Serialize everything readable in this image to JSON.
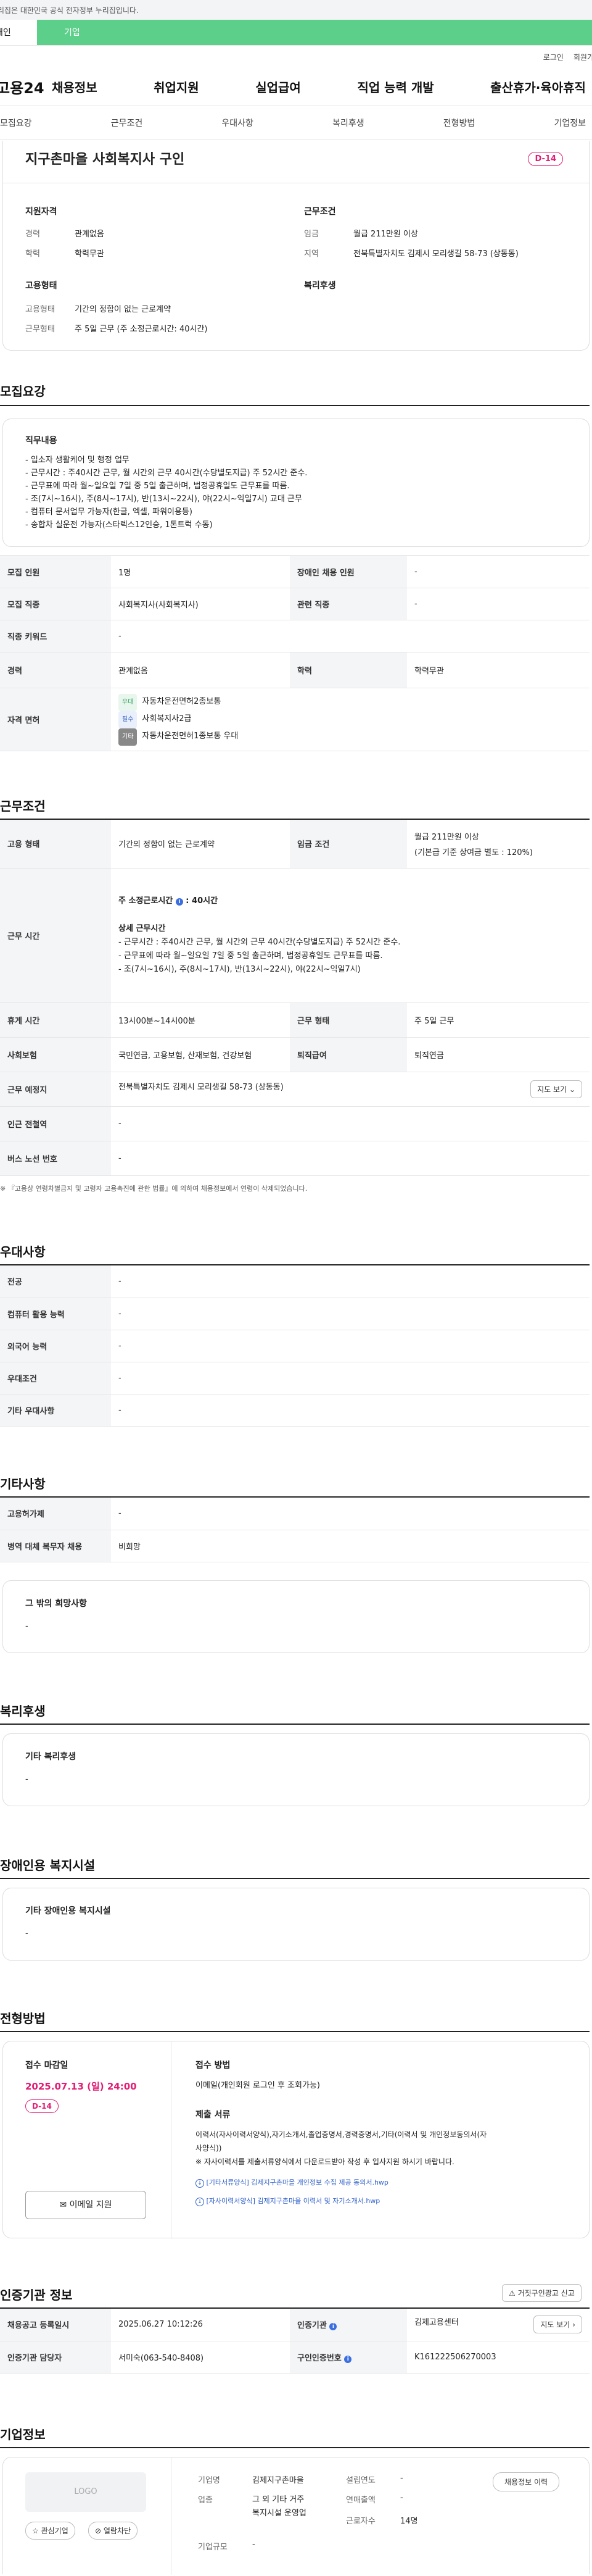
{
  "gov_banner": "이 누리집은 대한민국 공식 전자정부 누리집입니다.",
  "top_tabs": [
    "개인",
    "기업"
  ],
  "utility": {
    "login": "로그인",
    "join": "회원가입"
  },
  "logo": "고용24",
  "gnb": [
    "채용정보",
    "취업지원",
    "실업급여",
    "직업 능력 개발",
    "출산휴가·육아휴직"
  ],
  "subnav": [
    "모집요강",
    "근무조건",
    "우대사항",
    "복리후생",
    "전형방법",
    "기업정보"
  ],
  "header": {
    "title": "지구촌마을 사회복지사 구인",
    "dday": "D-14",
    "support_title": "지원자격",
    "career_label": "경력",
    "career_value": "관계없음",
    "edu_label": "학력",
    "edu_value": "학력무관",
    "cond_title": "근무조건",
    "wage_label": "임금",
    "wage_value": "월급 211만원 이상",
    "region_label": "지역",
    "region_value": "전북특별자치도 김제시 모리생길 58-73 (상동동)",
    "emp_title": "고용형태",
    "emp_label": "고용형태",
    "emp_value": "기간의 정함이 없는 근로계약",
    "worktype_label": "근무형태",
    "worktype_value": "주 5일 근무 (주 소정근로시간: 40시간)",
    "welfare_title": "복리후생"
  },
  "recruit": {
    "title": "모집요강",
    "duty_title": "직무내용",
    "duty_lines": [
      "- 입소자 생활케어 및 행정 업무",
      "- 근무시간 : 주40시간 근무, 월 시간외 근무 40시간(수당별도지급) 주 52시간 준수.",
      "- 근무표에 따라 월~일요일 7일 중 5일 출근하며, 법정공휴일도 근무표를 따름.",
      "- 조(7시~16시), 주(8시~17시), 반(13시~22시), 야(22시~익일7시) 교대 근무",
      "- 컴퓨터 문서업무 가능자(한글, 엑셀, 파워이용등)",
      "- 송합차 실운전 가능자(스타렉스12인승, 1톤트럭 수동)"
    ],
    "rows": {
      "count_l": "모집 인원",
      "count_v": "1명",
      "disabled_l": "장애인 채용 인원",
      "disabled_v": "-",
      "job_l": "모집 직종",
      "job_v": "사회복지사(사회복지사)",
      "rel_l": "관련 직종",
      "rel_v": "-",
      "kw_l": "직종 키워드",
      "kw_v": "-",
      "career_l": "경력",
      "career_v": "관계없음",
      "edu_l": "학력",
      "edu_v": "학력무관",
      "lic_l": "자격 면허",
      "licenses": [
        {
          "tag": "우대",
          "name": "자동차운전면허2종보통"
        },
        {
          "tag": "필수",
          "name": "사회복지사2급"
        },
        {
          "tag": "기타",
          "name": "자동차운전면허1종보통 우대"
        }
      ]
    }
  },
  "work": {
    "title": "근무조건",
    "emp_l": "고용 형태",
    "emp_v": "기간의 정함이 없는 근로계약",
    "wage_l": "임금 조건",
    "wage_v1": "월급 211만원 이상",
    "wage_v2": "(기본급 기준 상여금 별도 : 120%)",
    "time_l": "근무 시간",
    "time_head": "주 소정근로시간",
    "time_hours": "40시간",
    "time_detail_title": "상세 근무시간",
    "time_lines": [
      "- 근무시간 : 주40시간 근무, 월 시간외 근무 40시간(수당별도지급) 주 52시간 준수.",
      "- 근무표에 따라 월~일요일 7일 중 5일 출근하며, 법정공휴일도 근무표를 따름.",
      "- 조(7시~16시), 주(8시~17시), 반(13시~22시), 야(22시~익일7시)"
    ],
    "break_l": "휴게 시간",
    "break_v": "13시00분~14시00분",
    "wtype_l": "근무 형태",
    "wtype_v": "주 5일 근무",
    "ins_l": "사회보험",
    "ins_v": "국민연금, 고용보험, 산재보험, 건강보험",
    "sev_l": "퇴직급여",
    "sev_v": "퇴직연금",
    "place_l": "근무 예정지",
    "place_v": "전북특별자치도 김제시 모리생길 58-73 (상동동)",
    "map_btn": "지도 보기",
    "sub_l": "인근 전철역",
    "sub_v": "-",
    "bus_l": "버스 노선 번호",
    "bus_v": "-",
    "note": "※ 『고용상 연령차별금지 및 고령자 고용촉진에 관한 법률』에 의하여 채용정보에서 연령이 삭제되었습니다."
  },
  "pref": {
    "title": "우대사항",
    "rows": [
      [
        "전공",
        "-"
      ],
      [
        "컴퓨터 활용 능력",
        "-"
      ],
      [
        "외국어 능력",
        "-"
      ],
      [
        "우대조건",
        "-"
      ],
      [
        "기타 우대사항",
        "-"
      ]
    ]
  },
  "etc": {
    "title": "기타사항",
    "rows": [
      [
        "고용허가제",
        "-"
      ],
      [
        "병역 대체 복무자 채용",
        "비희망"
      ]
    ],
    "hope_title": "그 밖의 희망사항",
    "hope_v": "-"
  },
  "welfare": {
    "title": "복리후생",
    "box_title": "기타 복리후생",
    "box_v": "-"
  },
  "disabled": {
    "title": "장애인용 복지시설",
    "box_title": "기타 장애인용 복지시설",
    "box_v": "-"
  },
  "selection": {
    "title": "전형방법",
    "deadline_l": "접수 마감일",
    "deadline_v": "2025.07.13 (일) 24:00",
    "dday": "D-14",
    "apply_btn": "이메일 지원",
    "method_l": "접수 방법",
    "method_v": "이메일(개인회원 로그인 후 조회가능)",
    "docs_l": "제출 서류",
    "docs_v1": "이력서(자사이력서양식),자기소개서,졸업증명서,경력증명서,기타(이력서 및 개인정보동의서(자",
    "docs_v2": "사양식))",
    "docs_v3": "※ 자사이력서를 제출서류양식에서 다운로드받아 작성 후 입사지원 하시기 바랍니다.",
    "file1": "[기타서류양식] 김제지구촌마을 개인정보 수집 제공 동의서.hwp",
    "file2": "[자사이력서양식] 김제지구촌마을 이력서 및 자기소개서.hwp"
  },
  "auth": {
    "title": "인증기관 정보",
    "report_btn": "거짓구인광고 신고",
    "reg_l": "채용공고 등록일시",
    "reg_v": "2025.06.27 10:12:26",
    "org_l": "인증기관",
    "org_v": "김제고용센터",
    "map_btn": "지도 보기",
    "mgr_l": "인증기관 담당자",
    "mgr_v": "서미숙(063-540-8408)",
    "no_l": "구인인증번호",
    "no_v": "K161222506270003"
  },
  "company": {
    "title": "기업정보",
    "logo": "LOGO",
    "fav_btn": "관심기업",
    "open_btn": "열람차단",
    "name_l": "기업명",
    "name_v": "김제지구촌마을",
    "year_l": "설립연도",
    "year_v": "-",
    "ind_l": "업종",
    "ind_v1": "그 외 기타 거주",
    "ind_v2": "복지시설 운영업",
    "sales_l": "연매출액",
    "sales_v": "-",
    "emp_l": "근로자수",
    "emp_v": "14명",
    "scale_l": "기업규모",
    "scale_v": "-",
    "history_btn": "채용정보 이력"
  }
}
